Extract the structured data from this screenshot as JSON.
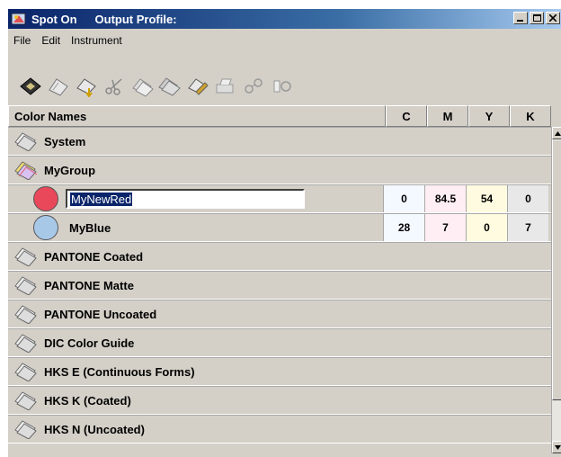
{
  "window": {
    "app_name": "Spot On",
    "title": "Output Profile:",
    "controls": {
      "minimize": "_",
      "maximize": "□",
      "close": "×"
    }
  },
  "menu": [
    "File",
    "Edit",
    "Instrument"
  ],
  "toolbar": [
    "save-icon",
    "library-icon",
    "import-icon",
    "scissors-icon",
    "copy-icon",
    "paste-icon",
    "edit-icon",
    "print-icon",
    "measure-icon",
    "compare-icon"
  ],
  "table": {
    "header": {
      "name": "Color Names",
      "c": "C",
      "m": "M",
      "y": "Y",
      "k": "K"
    }
  },
  "groups": {
    "system": "System",
    "mygroup": "MyGroup",
    "pantone_coated": "PANTONE Coated",
    "pantone_matte": "PANTONE Matte",
    "pantone_uncoated": "PANTONE Uncoated",
    "dic": "DIC Color Guide",
    "hks_e": "HKS E (Continuous Forms)",
    "hks_k": "HKS K (Coated)",
    "hks_n": "HKS N (Uncoated)"
  },
  "colors": [
    {
      "name": "MyNewRed",
      "c": "0",
      "m": "84.5",
      "y": "54",
      "k": "0",
      "swatch": "#e8485a"
    },
    {
      "name": "MyBlue",
      "c": "28",
      "m": "7",
      "y": "0",
      "k": "7",
      "swatch": "#a8c8e8"
    }
  ],
  "cell_colors": {
    "c": "#f4f8ff",
    "m": "#ffeef4",
    "y": "#fffbe0",
    "k": "#e8e8e8"
  }
}
